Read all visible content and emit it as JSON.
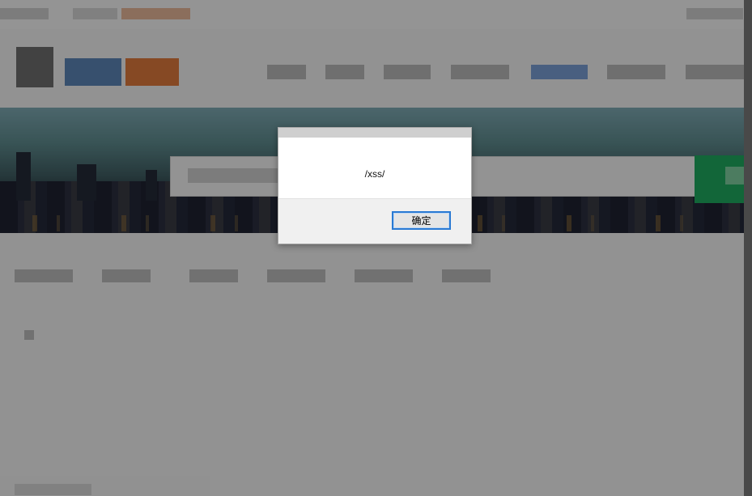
{
  "background_page": {
    "blurred": true,
    "top_nav_items": [
      "",
      "",
      "",
      "",
      "",
      "",
      ""
    ],
    "hero_search_placeholder": "",
    "category_tabs": [
      "",
      "",
      "",
      "",
      "",
      ""
    ]
  },
  "alert_dialog": {
    "message": "/xss/",
    "ok_button_label": "确定"
  },
  "colors": {
    "ok_button_border": "#2a7ad3",
    "search_button": "#1faa60",
    "overlay": "rgba(0,0,0,0.40)"
  }
}
